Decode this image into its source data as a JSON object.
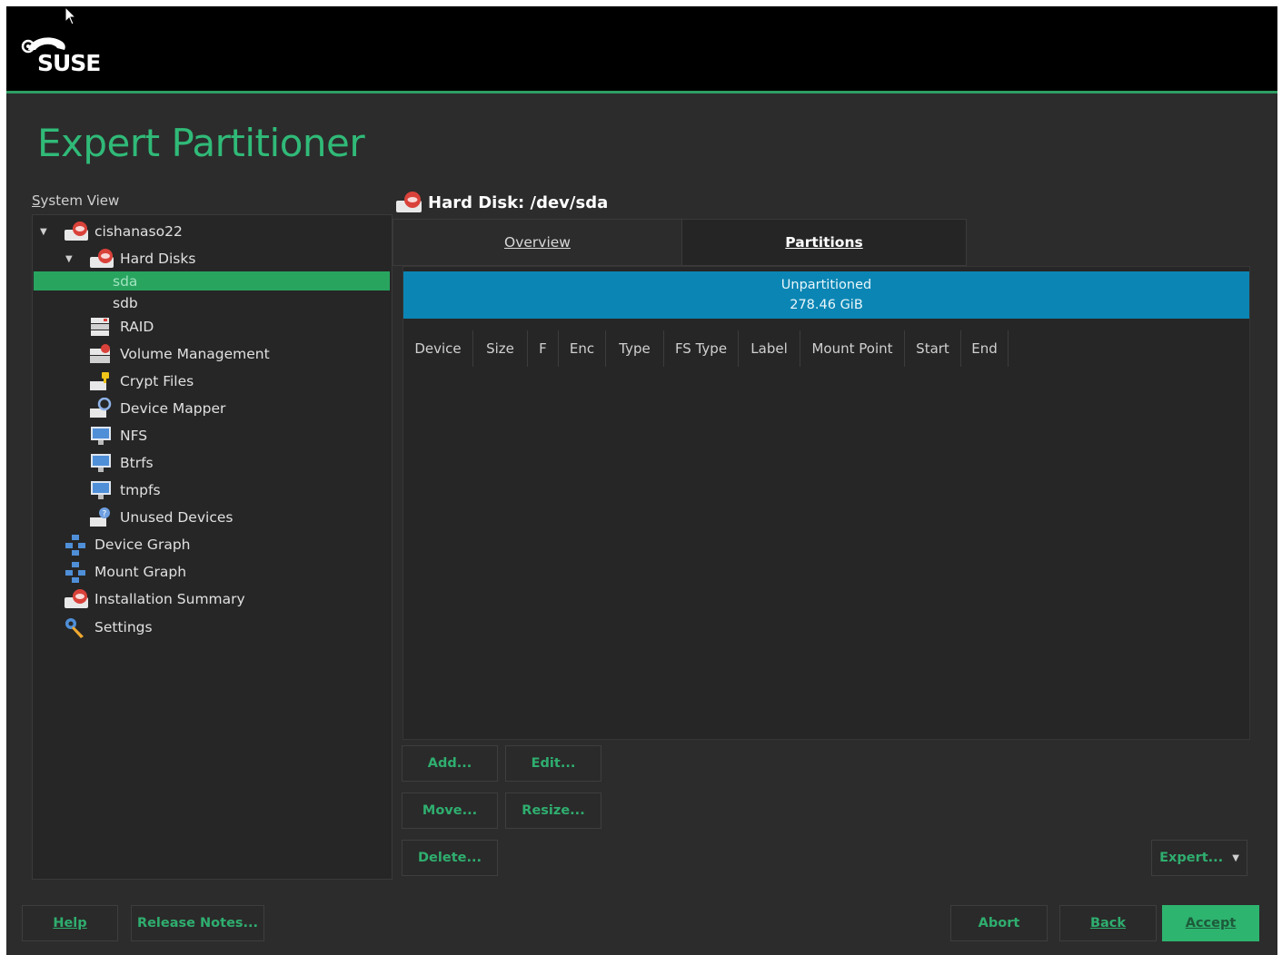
{
  "header": {
    "logo_text": "SUSE",
    "title": "Expert Partitioner"
  },
  "tree": {
    "label": "System View",
    "items": [
      {
        "label": "cishanaso22",
        "icon": "harddisk-icon"
      },
      {
        "label": "Hard Disks",
        "icon": "harddisk-icon"
      },
      {
        "label": "sda",
        "icon": "none"
      },
      {
        "label": "sdb",
        "icon": "none"
      },
      {
        "label": "RAID",
        "icon": "raid-icon"
      },
      {
        "label": "Volume Management",
        "icon": "lvm-icon"
      },
      {
        "label": "Crypt Files",
        "icon": "crypt-icon"
      },
      {
        "label": "Device Mapper",
        "icon": "device-mapper-icon"
      },
      {
        "label": "NFS",
        "icon": "nfs-icon"
      },
      {
        "label": "Btrfs",
        "icon": "btrfs-icon"
      },
      {
        "label": "tmpfs",
        "icon": "tmpfs-icon"
      },
      {
        "label": "Unused Devices",
        "icon": "unused-devices-icon"
      },
      {
        "label": "Device Graph",
        "icon": "graph-icon"
      },
      {
        "label": "Mount Graph",
        "icon": "graph-icon"
      },
      {
        "label": "Installation Summary",
        "icon": "harddisk-icon"
      },
      {
        "label": "Settings",
        "icon": "wrench-icon"
      }
    ],
    "selected": "sda"
  },
  "main": {
    "disk_title": "Hard Disk: /dev/sda",
    "tabs": [
      {
        "label": "Overview"
      },
      {
        "label": "Partitions"
      }
    ],
    "active_tab": "Partitions",
    "disk_bar": {
      "label": "Unpartitioned",
      "size": "278.46 GiB"
    },
    "columns": [
      "Device",
      "Size",
      "F",
      "Enc",
      "Type",
      "FS Type",
      "Label",
      "Mount Point",
      "Start",
      "End"
    ]
  },
  "actions": {
    "add": "Add...",
    "edit": "Edit...",
    "move": "Move...",
    "resize": "Resize...",
    "delete": "Delete...",
    "expert": "Expert..."
  },
  "footer": {
    "help": "Help",
    "release_notes": "Release Notes...",
    "abort": "Abort",
    "back": "Back",
    "accept": "Accept"
  },
  "colors": {
    "accent": "#30ba78",
    "disk_bar": "#0b86b4",
    "background": "#2c2c2c"
  }
}
